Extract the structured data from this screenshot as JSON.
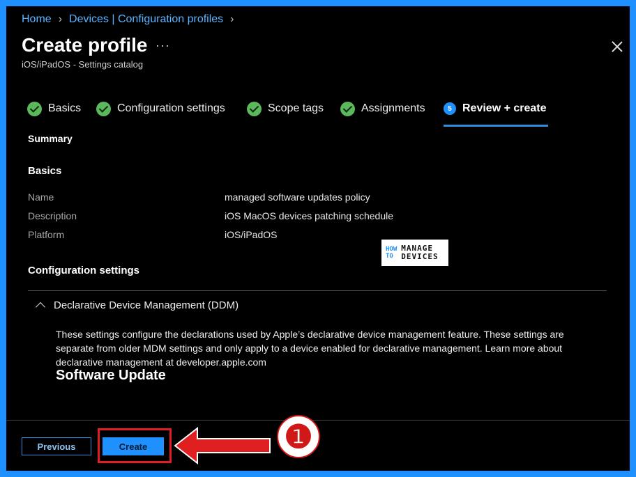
{
  "breadcrumb": {
    "home": "Home",
    "devices": "Devices | Configuration profiles"
  },
  "header": {
    "title": "Create profile",
    "more": "···",
    "subtitle": "iOS/iPadOS - Settings catalog"
  },
  "steps": [
    {
      "label": "Basics",
      "state": "complete"
    },
    {
      "label": "Configuration settings",
      "state": "complete"
    },
    {
      "label": "Scope tags",
      "state": "complete"
    },
    {
      "label": "Assignments",
      "state": "complete"
    },
    {
      "label": "Review + create",
      "state": "active",
      "number": "5"
    }
  ],
  "summary": {
    "heading": "Summary"
  },
  "basics": {
    "heading": "Basics",
    "fields": [
      {
        "label": "Name",
        "value": "managed software updates policy"
      },
      {
        "label": "Description",
        "value": " iOS MacOS devices patching schedule"
      },
      {
        "label": "Platform",
        "value": "iOS/iPadOS"
      }
    ]
  },
  "logo": {
    "line1": "HOW",
    "line2": "TO",
    "line3": "MANAGE",
    "line4": "DEVICES"
  },
  "config": {
    "heading": "Configuration settings",
    "ddm_title": "Declarative Device Management (DDM)",
    "ddm_description": "These settings configure the declarations used by Apple’s declarative device management feature. These settings are separate from older MDM settings and only apply to a device enabled for declarative management. Learn more about declarative management at developer.apple.com",
    "software_update": "Software Update"
  },
  "footer": {
    "previous": "Previous",
    "create": "Create"
  },
  "annotation": {
    "badge": "❶"
  },
  "colors": {
    "accent": "#1e90ff",
    "check": "#5cb85c",
    "highlight": "#e02020"
  }
}
